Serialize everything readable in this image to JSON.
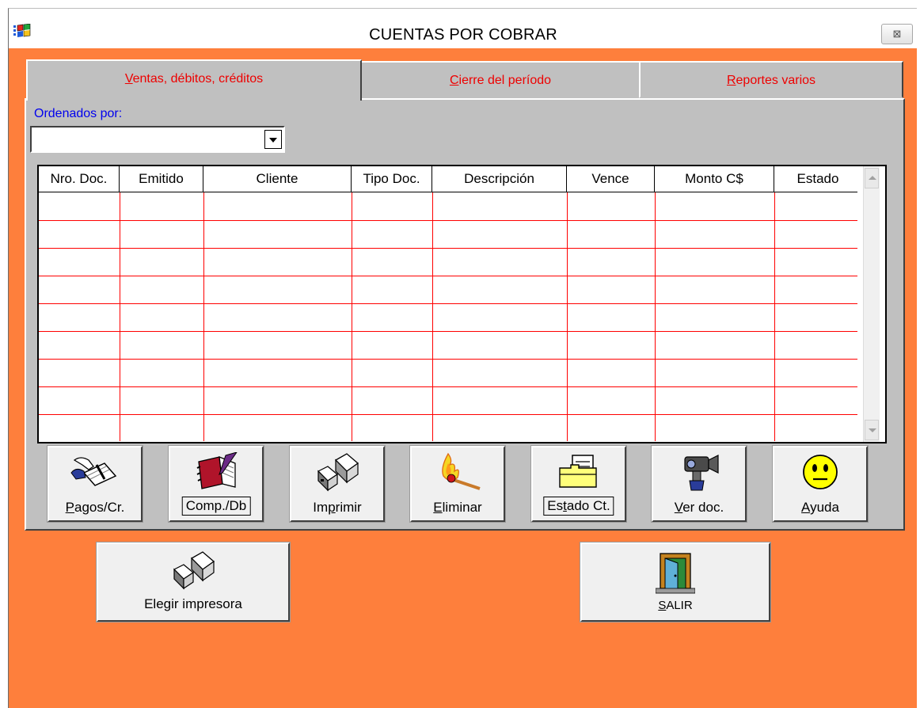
{
  "window": {
    "title": "CUENTAS POR COBRAR",
    "close_symbol": "⊠"
  },
  "tabs": [
    {
      "pre": "",
      "u": "V",
      "post": "entas, débitos, créditos",
      "active": true
    },
    {
      "pre": "",
      "u": "C",
      "post": "ierre del período",
      "active": false
    },
    {
      "pre": "",
      "u": "R",
      "post": "eportes varios",
      "active": false
    }
  ],
  "order": {
    "label": "Ordenados por:",
    "value": ""
  },
  "grid": {
    "columns": [
      "Nro. Doc.",
      "Emitido",
      "Cliente",
      "Tipo Doc.",
      "Descripción",
      "Vence",
      "Monto  C$",
      "Estado"
    ],
    "rows": []
  },
  "actions": [
    {
      "pre": "",
      "u": "P",
      "post": "agos/Cr.",
      "icon": "payment-hand-icon"
    },
    {
      "pre": "Comp./Db",
      "u": "",
      "post": "",
      "icon": "notebook-pencil-icon"
    },
    {
      "pre": "Im",
      "u": "p",
      "post": "rimir",
      "icon": "printer-icon"
    },
    {
      "pre": "",
      "u": "E",
      "post": "liminar",
      "icon": "burning-match-icon"
    },
    {
      "pre": "Es",
      "u": "t",
      "post": "ado Ct.",
      "icon": "document-folder-icon"
    },
    {
      "pre": "",
      "u": "V",
      "post": "er doc.",
      "icon": "camera-icon"
    },
    {
      "pre": "",
      "u": "A",
      "post": "yuda",
      "icon": "smiley-face-icon"
    }
  ],
  "bottom": {
    "printer_pre": "Ele",
    "printer_u": "g",
    "printer_post": "ir impresora",
    "exit_pre": "",
    "exit_u": "S",
    "exit_post": "ALIR"
  },
  "colors": {
    "background": "#fe7f3c",
    "panel": "#c0c0c0",
    "tab_text": "#ee0000",
    "grid_lines": "#ff0000",
    "label_blue": "#0000ee"
  }
}
